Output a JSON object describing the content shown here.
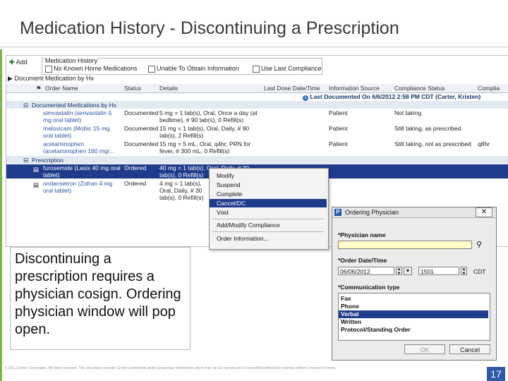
{
  "slide": {
    "title": "Medication History -  Discontinuing a Prescription",
    "caption": "Discontinuing a prescription requires a physician cosign. Ordering physician window will pop open.",
    "footer": "© 2011 Cerner Corporation. All rights reserved. This document contains Cerner confidential and/or proprietary information which may not be reproduced or transmitted without the express written consent of Cerner.",
    "page_number": "17"
  },
  "toolbar": {
    "add_label": "Add",
    "medication_history_label": "Medication History",
    "option_no_known": "No Known Home Medications",
    "option_unable": "Unable To Obtain Information",
    "option_use_last": "Use Last Compliance"
  },
  "grid": {
    "document_label": "Document Medication by Hx",
    "columns": [
      "Order Name",
      "Status",
      "Details",
      "Last Dose Date/Time",
      "Information Source",
      "Compliance Status",
      "Complia"
    ],
    "last_documented": "Last Documented On 6/6/2012 2:58 PM CDT (Carter, Kristen)",
    "sections": [
      "Documented Medications by Hx",
      "Prescription"
    ],
    "documented_rows": [
      {
        "name": "simvastatin (simvastatin 5 mg oral tablet)",
        "status": "Documented",
        "details": "5 mg = 1 tab(s), Oral, Once a day (at bedtime), # 90 tab(s), 0 Refill(s)",
        "source": "Patient",
        "compliance": "Not taking",
        "extra": ""
      },
      {
        "name": "meloxicam (Mobic 15 mg oral tablet)",
        "status": "Documented",
        "details": "15 mg = 1 tab(s), Oral, Daily, # 90 tab(s), 2 Refill(s)",
        "source": "Patient",
        "compliance": "Still taking, as prescribed",
        "extra": ""
      },
      {
        "name": "acetaminophen (acetaminophen 160 mg/...",
        "status": "Documented",
        "details": "15 mg = 5 mL, Oral, q4hr, PRN for fever, # 300 mL, 0 Refill(s)",
        "source": "Patient",
        "compliance": "Still taking, not as prescribed",
        "extra": "q8hr"
      }
    ],
    "prescription_rows": [
      {
        "name": "furosemide (Lasix 40 mg oral tablet)",
        "status": "Ordered",
        "details": "40 mg = 1 tab(s), Oral, Daily, # 30 tab(s), 0 Refill(s)"
      },
      {
        "name": "ondansetron (Zofran 4 mg oral tablet)",
        "status": "Ordered",
        "details": "4 mg = 1 tab(s), Oral, Daily, # 30 tab(s), 0 Refill(s)"
      }
    ]
  },
  "context_menu": {
    "items": [
      "Modify",
      "Suspend",
      "Complete",
      "Cancel/DC",
      "Void",
      "Add/Modify Compliance",
      "Order Information..."
    ],
    "highlighted": "Cancel/DC"
  },
  "dialog": {
    "title": "Ordering Physician",
    "physician_label": "*Physician name",
    "physician_value": "",
    "date_label": "*Order Date/Time",
    "date_value": "06/06/2012",
    "time_value": "1501",
    "timezone": "CDT",
    "comm_label": "*Communication type",
    "comm_options": [
      "Fax",
      "Phone",
      "Verbal",
      "Written",
      "Protocol/Standing Order"
    ],
    "comm_selected": "Verbal",
    "ok_label": "OK",
    "cancel_label": "Cancel"
  },
  "colors": {
    "selection": "#1f3b8c",
    "accent": "#7ab648",
    "slide_number_bg": "#2d5ba8",
    "physician_field": "#fffcc8"
  }
}
